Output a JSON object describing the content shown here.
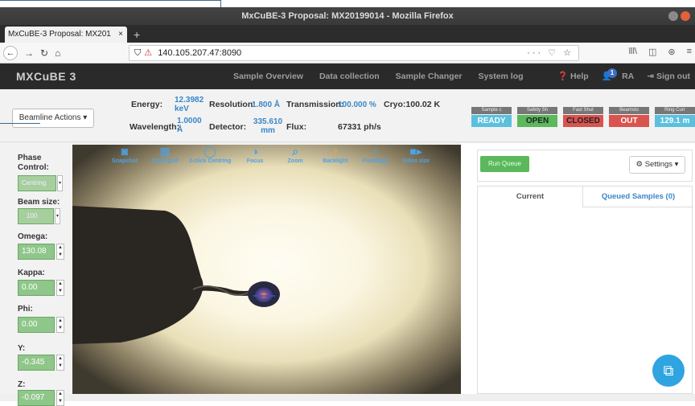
{
  "window": {
    "title": "MxCuBE-3 Proposal: MX20199014 - Mozilla Firefox"
  },
  "browser": {
    "tab_title": "MxCuBE-3 Proposal: MX201",
    "tab_close": "×",
    "new_tab": "+",
    "url": "140.105.207.47:8090",
    "url_right": "··· ♡ ☆",
    "toolbar_right": [
      "lll\\",
      "◫",
      "⊛",
      "≡"
    ]
  },
  "app": {
    "brand": "MXCuBE 3",
    "nav": [
      "Sample Overview",
      "Data collection",
      "Sample Changer",
      "System log"
    ],
    "help": "Help",
    "user_badge": "1",
    "user": "RA",
    "sign_out": "Sign out"
  },
  "beamline": {
    "actions_label": "Beamline Actions ▾",
    "energy_label": "Energy:",
    "energy_value": "12.3982 keV",
    "wavelength_label": "Wavelength:",
    "wavelength_value": "1.0000 Å",
    "resolution_label": "Resolution:",
    "resolution_value": "1.800 Å",
    "detector_label": "Detector:",
    "detector_value": "335.610 mm",
    "transmission_label": "Transmission:",
    "transmission_value": "100.000 %",
    "flux_label": "Flux:",
    "flux_value": "67331 ph/s",
    "cryo_label": "Cryo:",
    "cryo_value": "100.02 K",
    "status_blocks": [
      {
        "head": "Sample c",
        "value": "READY",
        "color": "#5bc0de"
      },
      {
        "head": "Safety Sh",
        "value": "OPEN",
        "color": "#5cb85c"
      },
      {
        "head": "Fast Shut",
        "value": "CLOSED",
        "color": "#d9534f"
      },
      {
        "head": "Beamsto",
        "value": "OUT",
        "color": "#d9534f"
      },
      {
        "head": "Ring Curr",
        "value": "129.1 m",
        "color": "#5bc0de"
      }
    ]
  },
  "motors": {
    "phase_label": "Phase Control:",
    "phase_value": "Centring",
    "beam_label": "Beam size:",
    "beam_value": "100",
    "omega_label": "Omega:",
    "omega_value": "130.08",
    "kappa_label": "Kappa:",
    "kappa_value": "0.00",
    "phi_label": "Phi:",
    "phi_value": "0.00",
    "y_label": "Y:",
    "y_value": "-0.345",
    "z_label": "Z:",
    "z_value": "-0.097"
  },
  "video_tools": [
    {
      "icon": "camera-icon",
      "glyph": "📷",
      "label": "Snapshot"
    },
    {
      "icon": "grid-icon",
      "glyph": "▦",
      "label": "Draw grid"
    },
    {
      "icon": "circle-icon",
      "glyph": "◯",
      "label": "3-click Centring"
    },
    {
      "icon": "focus-icon",
      "glyph": "◐",
      "label": "Focus"
    },
    {
      "icon": "zoom-icon",
      "glyph": "🔍",
      "label": "Zoom"
    },
    {
      "icon": "bulb-icon",
      "glyph": "💡",
      "label": "Backlight"
    },
    {
      "icon": "bulb-icon",
      "glyph": "💡",
      "label": "Frontlight"
    },
    {
      "icon": "video-icon",
      "glyph": "🎥",
      "label": "Video size"
    }
  ],
  "queue": {
    "run_label": "Run Queue",
    "settings_label": "⚙ Settings ▾",
    "tab_current": "Current",
    "tab_queued": "Queued Samples (0)"
  }
}
